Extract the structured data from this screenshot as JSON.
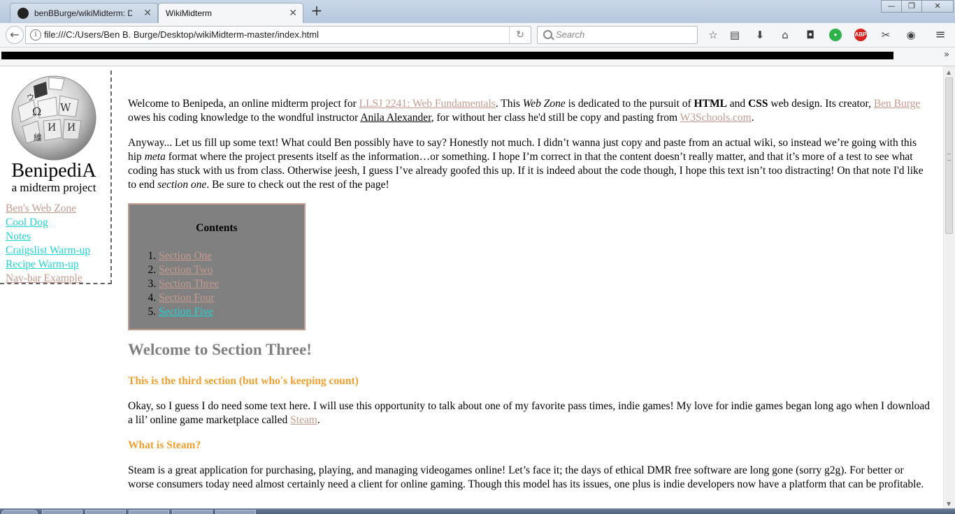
{
  "browser": {
    "tabs": [
      {
        "title": "benBBurge/wikiMidterm: Du",
        "close": "✕"
      },
      {
        "title": "WikiMidterm",
        "close": "✕"
      }
    ],
    "new_tab": "+",
    "window": {
      "minimize": "—",
      "restore": "❐",
      "close": "✕"
    },
    "back": "←",
    "info": "i",
    "url": "file:///C:/Users/Ben B. Burge/Desktop/wikiMidterm-master/index.html",
    "reload": "↻",
    "search_placeholder": "Search",
    "toolbar_icons": [
      "star-icon",
      "reading-list-icon",
      "download-icon",
      "home-icon",
      "pocket-icon",
      "evernote-icon",
      "adblock-icon",
      "screenshot-icon",
      "sync-icon",
      "menu-icon"
    ],
    "adblock_label": "ABP",
    "bookmarks_overflow": "»"
  },
  "page": {
    "sidebar": {
      "site_name": "BenipediA",
      "tagline": "a midterm project",
      "links": [
        {
          "label": "Ben's Web Zone",
          "state": "visited"
        },
        {
          "label": "Cool Dog",
          "state": "fresh"
        },
        {
          "label": "Notes",
          "state": "fresh"
        },
        {
          "label": "Craigslist Warm-up",
          "state": "fresh"
        },
        {
          "label": "Recipe Warm-up",
          "state": "fresh"
        },
        {
          "label": "Nav-bar Example",
          "state": "visited"
        }
      ]
    },
    "intro": {
      "t1": "Welcome to Benipeda, an online midterm project for ",
      "link_course": "LLSJ 2241: Web Fundamentals",
      "t2": ". This ",
      "em_webzone": "Web Zone",
      "t3": " is dedicated to the pursuit of ",
      "b_html": "HTML",
      "t4": " and ",
      "b_css": "CSS",
      "t5": " web design. Its creator, ",
      "link_ben": "Ben Burge",
      "t6": " owes his coding knowledge to the wondful instructor ",
      "link_anila": "Anila Alexander",
      "t7": ", for without her class he'd still be copy and pasting from ",
      "link_w3": "W3Schools.com",
      "t8": "."
    },
    "anyway": {
      "t1": "Anyway... Let us fill up some text! What could Ben possibly have to say? Honestly not much. I didn’t wanna just copy and paste from an actual wiki, so instead we’re going with this hip ",
      "em_meta": "meta",
      "t2": " format where the project presents itself as the information…or something. I hope I’m correct in that the content doesn’t really matter, and that it’s more of a test to see what coding has stuck with us from class. Otherwise jeesh, I guess I’ve already goofed this up. If it is indeed about the code though, I hope this text isn’t too distracting! On that note I'd like to end ",
      "em_section": "section one",
      "t3": ". Be sure to check out the rest of the page!"
    },
    "contents": {
      "title": "Contents",
      "items": [
        {
          "label": "Section One",
          "state": "visited"
        },
        {
          "label": "Section Two",
          "state": "visited"
        },
        {
          "label": "Section Three",
          "state": "visited"
        },
        {
          "label": "Section Four",
          "state": "visited"
        },
        {
          "label": "Section Five",
          "state": "fresh"
        }
      ]
    },
    "section3": {
      "heading": "Welcome to Section Three!",
      "subheading": "This is the third section (but who's keeping count)",
      "p1_t1": "Okay, so I guess I do need some text here. I will use this opportunity to talk about one of my favorite pass times, indie games! My love for indie games began long ago when I download a lil’ online game marketplace called ",
      "p1_link": "Steam",
      "p1_t2": ".",
      "subheading2": "What is Steam?",
      "p2": "Steam is a great application for purchasing, playing, and managing videogames online! Let’s face it; the days of ethical DMR free software are long gone (sorry g2g). For better or worse consumers today need almost certainly need a client for online gaming. Though this model has its issues, one plus is indie developers now have a platform that can be profitable."
    }
  },
  "colors": {
    "visited_link": "#c39a8e",
    "fresh_link": "#22d3d3",
    "section_heading": "#808080",
    "subheading": "#f0a030",
    "contents_bg": "#808080"
  }
}
